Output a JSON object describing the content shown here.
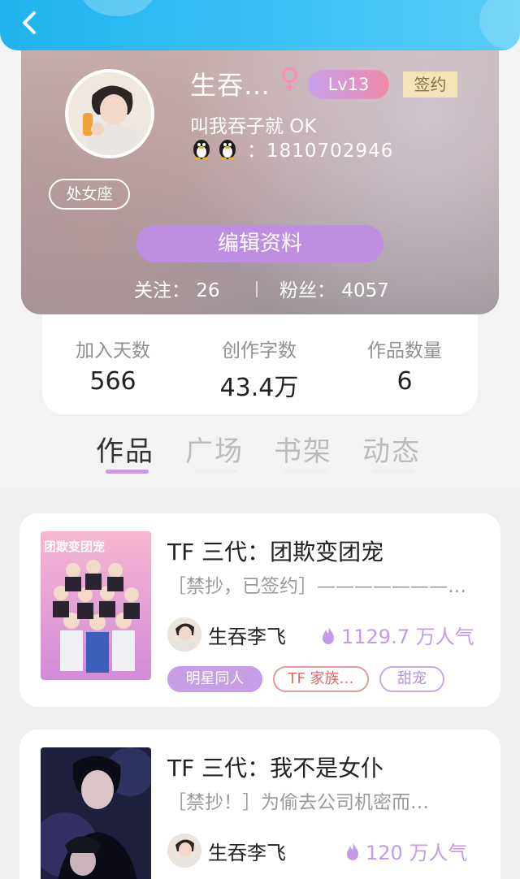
{
  "profile": {
    "nickname": "生吞…",
    "gender_icon": "female-icon",
    "level": "Lv13",
    "sign_badge": "签约",
    "signature": "叫我吞子就 OK",
    "qq_label": "：1810702946",
    "zodiac": "处女座",
    "edit_button": "编辑资料",
    "following": "关注：  26",
    "fans": "粉丝：  4057"
  },
  "stats": [
    {
      "label": "加入天数",
      "value": "566"
    },
    {
      "label": "创作字数",
      "value": "43.4万"
    },
    {
      "label": "作品数量",
      "value": "6"
    }
  ],
  "tabs": [
    {
      "label": "作品",
      "active": true
    },
    {
      "label": "广场",
      "active": false
    },
    {
      "label": "书架",
      "active": false
    },
    {
      "label": "动态",
      "active": false
    }
  ],
  "works": [
    {
      "title": "TF 三代：团欺变团宠",
      "desc": "［禁抄，已签约］———————…",
      "author": "生吞李飞",
      "popularity": "1129.7 万人气",
      "cover_text": "团欺变团宠",
      "tags": [
        "明星同人",
        "TF 家族…",
        "甜宠"
      ]
    },
    {
      "title": "TF 三代：我不是女仆",
      "desc": "［禁抄！］为偷去公司机密而…",
      "author": "生吞李飞",
      "popularity": "120 万人气"
    }
  ],
  "colors": {
    "header": "#1fb3ef",
    "accent": "#c89ae6",
    "level_badge": "#f08aa7",
    "sign_badge": "#f3e4b7"
  }
}
